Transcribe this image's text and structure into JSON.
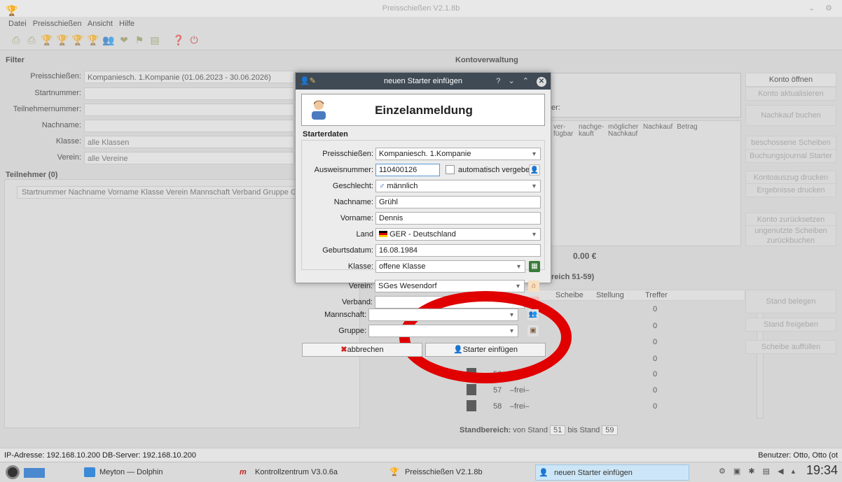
{
  "window": {
    "title": "Preisschießen V2.1.8b"
  },
  "menu": [
    "Datei",
    "Preisschießen",
    "Ansicht",
    "Hilfe"
  ],
  "filter": {
    "title": "Filter",
    "fields": [
      {
        "label": "Preisschießen:",
        "value": "Kompaniesch. 1.Kompanie (01.06.2023 - 30.06.2026)"
      },
      {
        "label": "Startnummer:",
        "value": ""
      },
      {
        "label": "Teilnehmernummer:",
        "value": ""
      },
      {
        "label": "Nachname:",
        "value": ""
      },
      {
        "label": "Klasse:",
        "value": "alle Klassen"
      },
      {
        "label": "Verein:",
        "value": "alle Vereine"
      }
    ]
  },
  "participants": {
    "title": "Teilnehmer (0)",
    "columns": "Startnummer Nachname Vorname Klasse Verein Mannschaft Verband Gruppe Gebu"
  },
  "account": {
    "title": "Kontoverwaltung",
    "partial_label": "er:",
    "columns": [
      "ver-fügbar",
      "nachge-kauft",
      "möglicher Nachkauf",
      "Nachkauf",
      "Betrag"
    ],
    "total": "0.00 €",
    "range_title": "reich 51-59)",
    "table_headers": [
      "Scheibe",
      "Stellung",
      "Treffer"
    ],
    "rows": [
      {
        "num": "",
        "name": "",
        "val": "0"
      },
      {
        "num": "",
        "name": "",
        "val": "0"
      },
      {
        "num": "",
        "name": "",
        "val": "0"
      },
      {
        "num": "",
        "name": "",
        "val": "0"
      },
      {
        "num": "56",
        "name": "–frei–",
        "val": "0"
      },
      {
        "num": "57",
        "name": "–frei–",
        "val": "0"
      },
      {
        "num": "58",
        "name": "–frei–",
        "val": "0"
      }
    ],
    "standbereich": {
      "label": "Standbereich:",
      "from_label": "von Stand",
      "from": "51",
      "to_label": "bis Stand",
      "to": "59"
    }
  },
  "right_buttons": [
    "Konto öffnen",
    "Konto aktualisieren",
    "Nachkauf buchen",
    "beschossene Scheiben",
    "Buchungsjournal Starter",
    "Kontoauszug drucken",
    "Ergebnisse drucken",
    "Konto zurücksetzen",
    "ungenutzte Scheiben zurückbuchen",
    "Stand belegen",
    "Stand freigeben",
    "Scheibe auffüllen"
  ],
  "dialog": {
    "title": "neuen Starter einfügen",
    "heading": "Einzelanmeldung",
    "section": "Starterdaten",
    "fields": [
      {
        "label": "Preisschießen:",
        "value": "Kompaniesch. 1.Kompanie"
      },
      {
        "label": "Ausweisnummer:",
        "value": "110400126"
      },
      {
        "label": "Geschlecht:",
        "value": "männlich"
      },
      {
        "label": "Nachname:",
        "value": "Grühl"
      },
      {
        "label": "Vorname:",
        "value": "Dennis"
      },
      {
        "label": "Land",
        "value": "GER - Deutschland"
      },
      {
        "label": "Geburtsdatum:",
        "value": "16.08.1984"
      },
      {
        "label": "Klasse:",
        "value": "offene Klasse"
      },
      {
        "label": "Verein:",
        "value": "SGes Wesendorf"
      },
      {
        "label": "Verband:",
        "value": ""
      },
      {
        "label": "Mannschaft:",
        "value": ""
      },
      {
        "label": "Gruppe:",
        "value": ""
      }
    ],
    "auto_label": "automatisch vergeben",
    "cancel": "abbrechen",
    "submit": "Starter einfügen"
  },
  "status": {
    "left": "IP-Adresse: 192.168.10.200 DB-Server: 192.168.10.200",
    "right": "Benutzer: Otto, Otto (ot"
  },
  "taskbar": {
    "items": [
      "Meyton — Dolphin",
      "Kontrollzentrum V3.0.6a",
      "Preisschießen V2.1.8b",
      "neuen Starter einfügen"
    ],
    "clock": "19:34"
  },
  "colors": {
    "accent_red": "#e00000",
    "dialog_title": "#3f4a55"
  }
}
